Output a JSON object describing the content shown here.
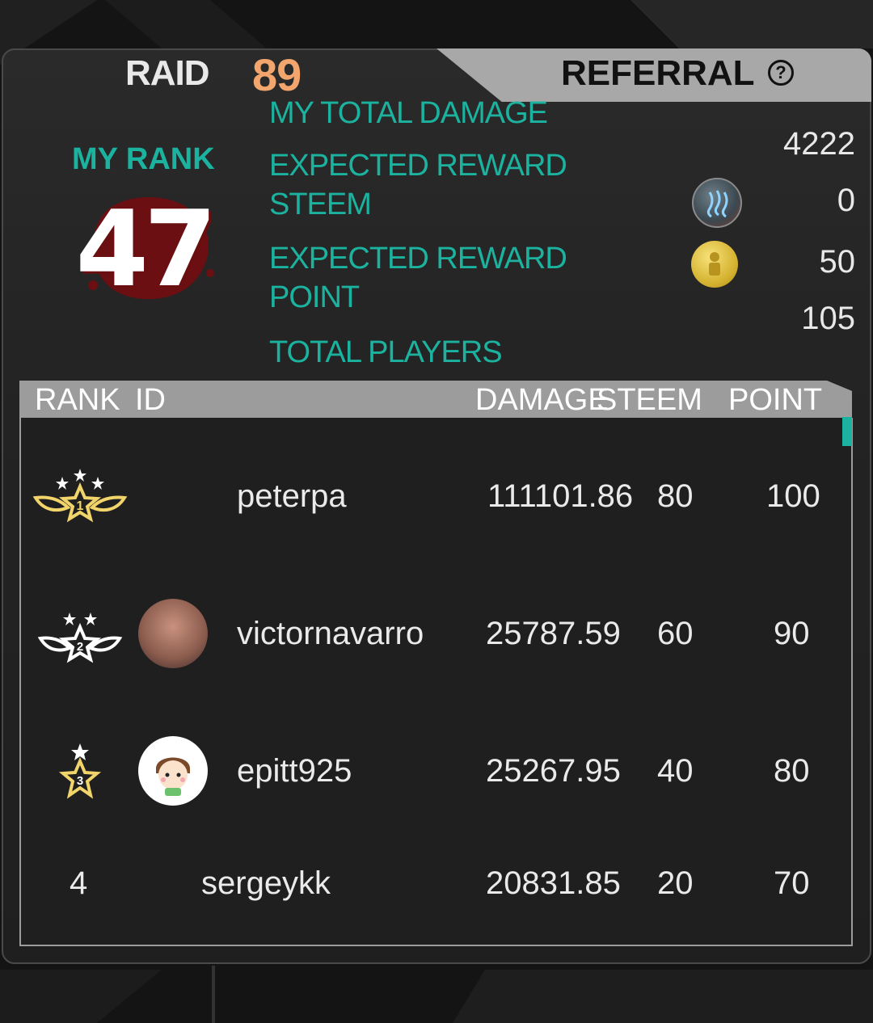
{
  "header": {
    "raid_label": "RAID",
    "raid_number": "89",
    "referral_label": "REFERRAL",
    "help_symbol": "?"
  },
  "my_rank": {
    "label": "MY RANK",
    "value": "47"
  },
  "stats": {
    "total_damage_label": "MY TOTAL DAMAGE",
    "total_damage_value": "4222",
    "reward_steem_label_1": "EXPECTED REWARD",
    "reward_steem_label_2": "STEEM",
    "reward_steem_value": "0",
    "reward_point_label_1": "EXPECTED REWARD",
    "reward_point_label_2": "POINT",
    "reward_point_value": "50",
    "total_players_label": "TOTAL PLAYERS",
    "total_players_value": "105"
  },
  "table": {
    "headers": {
      "rank": "RANK",
      "id": "ID",
      "damage": "DAMAGE",
      "steem": "STEEM",
      "point": "POINT"
    },
    "rows": [
      {
        "rank": "1",
        "id": "peterpa",
        "damage": "111101.86",
        "steem": "80",
        "point": "100"
      },
      {
        "rank": "2",
        "id": "victornavarro",
        "damage": "25787.59",
        "steem": "60",
        "point": "90"
      },
      {
        "rank": "3",
        "id": "epitt925",
        "damage": "25267.95",
        "steem": "40",
        "point": "80"
      },
      {
        "rank": "4",
        "id": "sergeykk",
        "damage": "20831.85",
        "steem": "20",
        "point": "70"
      }
    ]
  },
  "colors": {
    "accent_teal": "#1bb39f",
    "raid_orange": "#f2a56c",
    "gold": "#f1d46a",
    "silver": "#ffffff"
  },
  "icons": {
    "help": "question-circle-icon",
    "steem_coin": "steem-coin-icon",
    "point_coin": "point-coin-icon",
    "medal_1": "gold-winged-star-medal-icon",
    "medal_2": "silver-winged-star-medal-icon",
    "medal_3": "bronze-star-medal-icon"
  }
}
